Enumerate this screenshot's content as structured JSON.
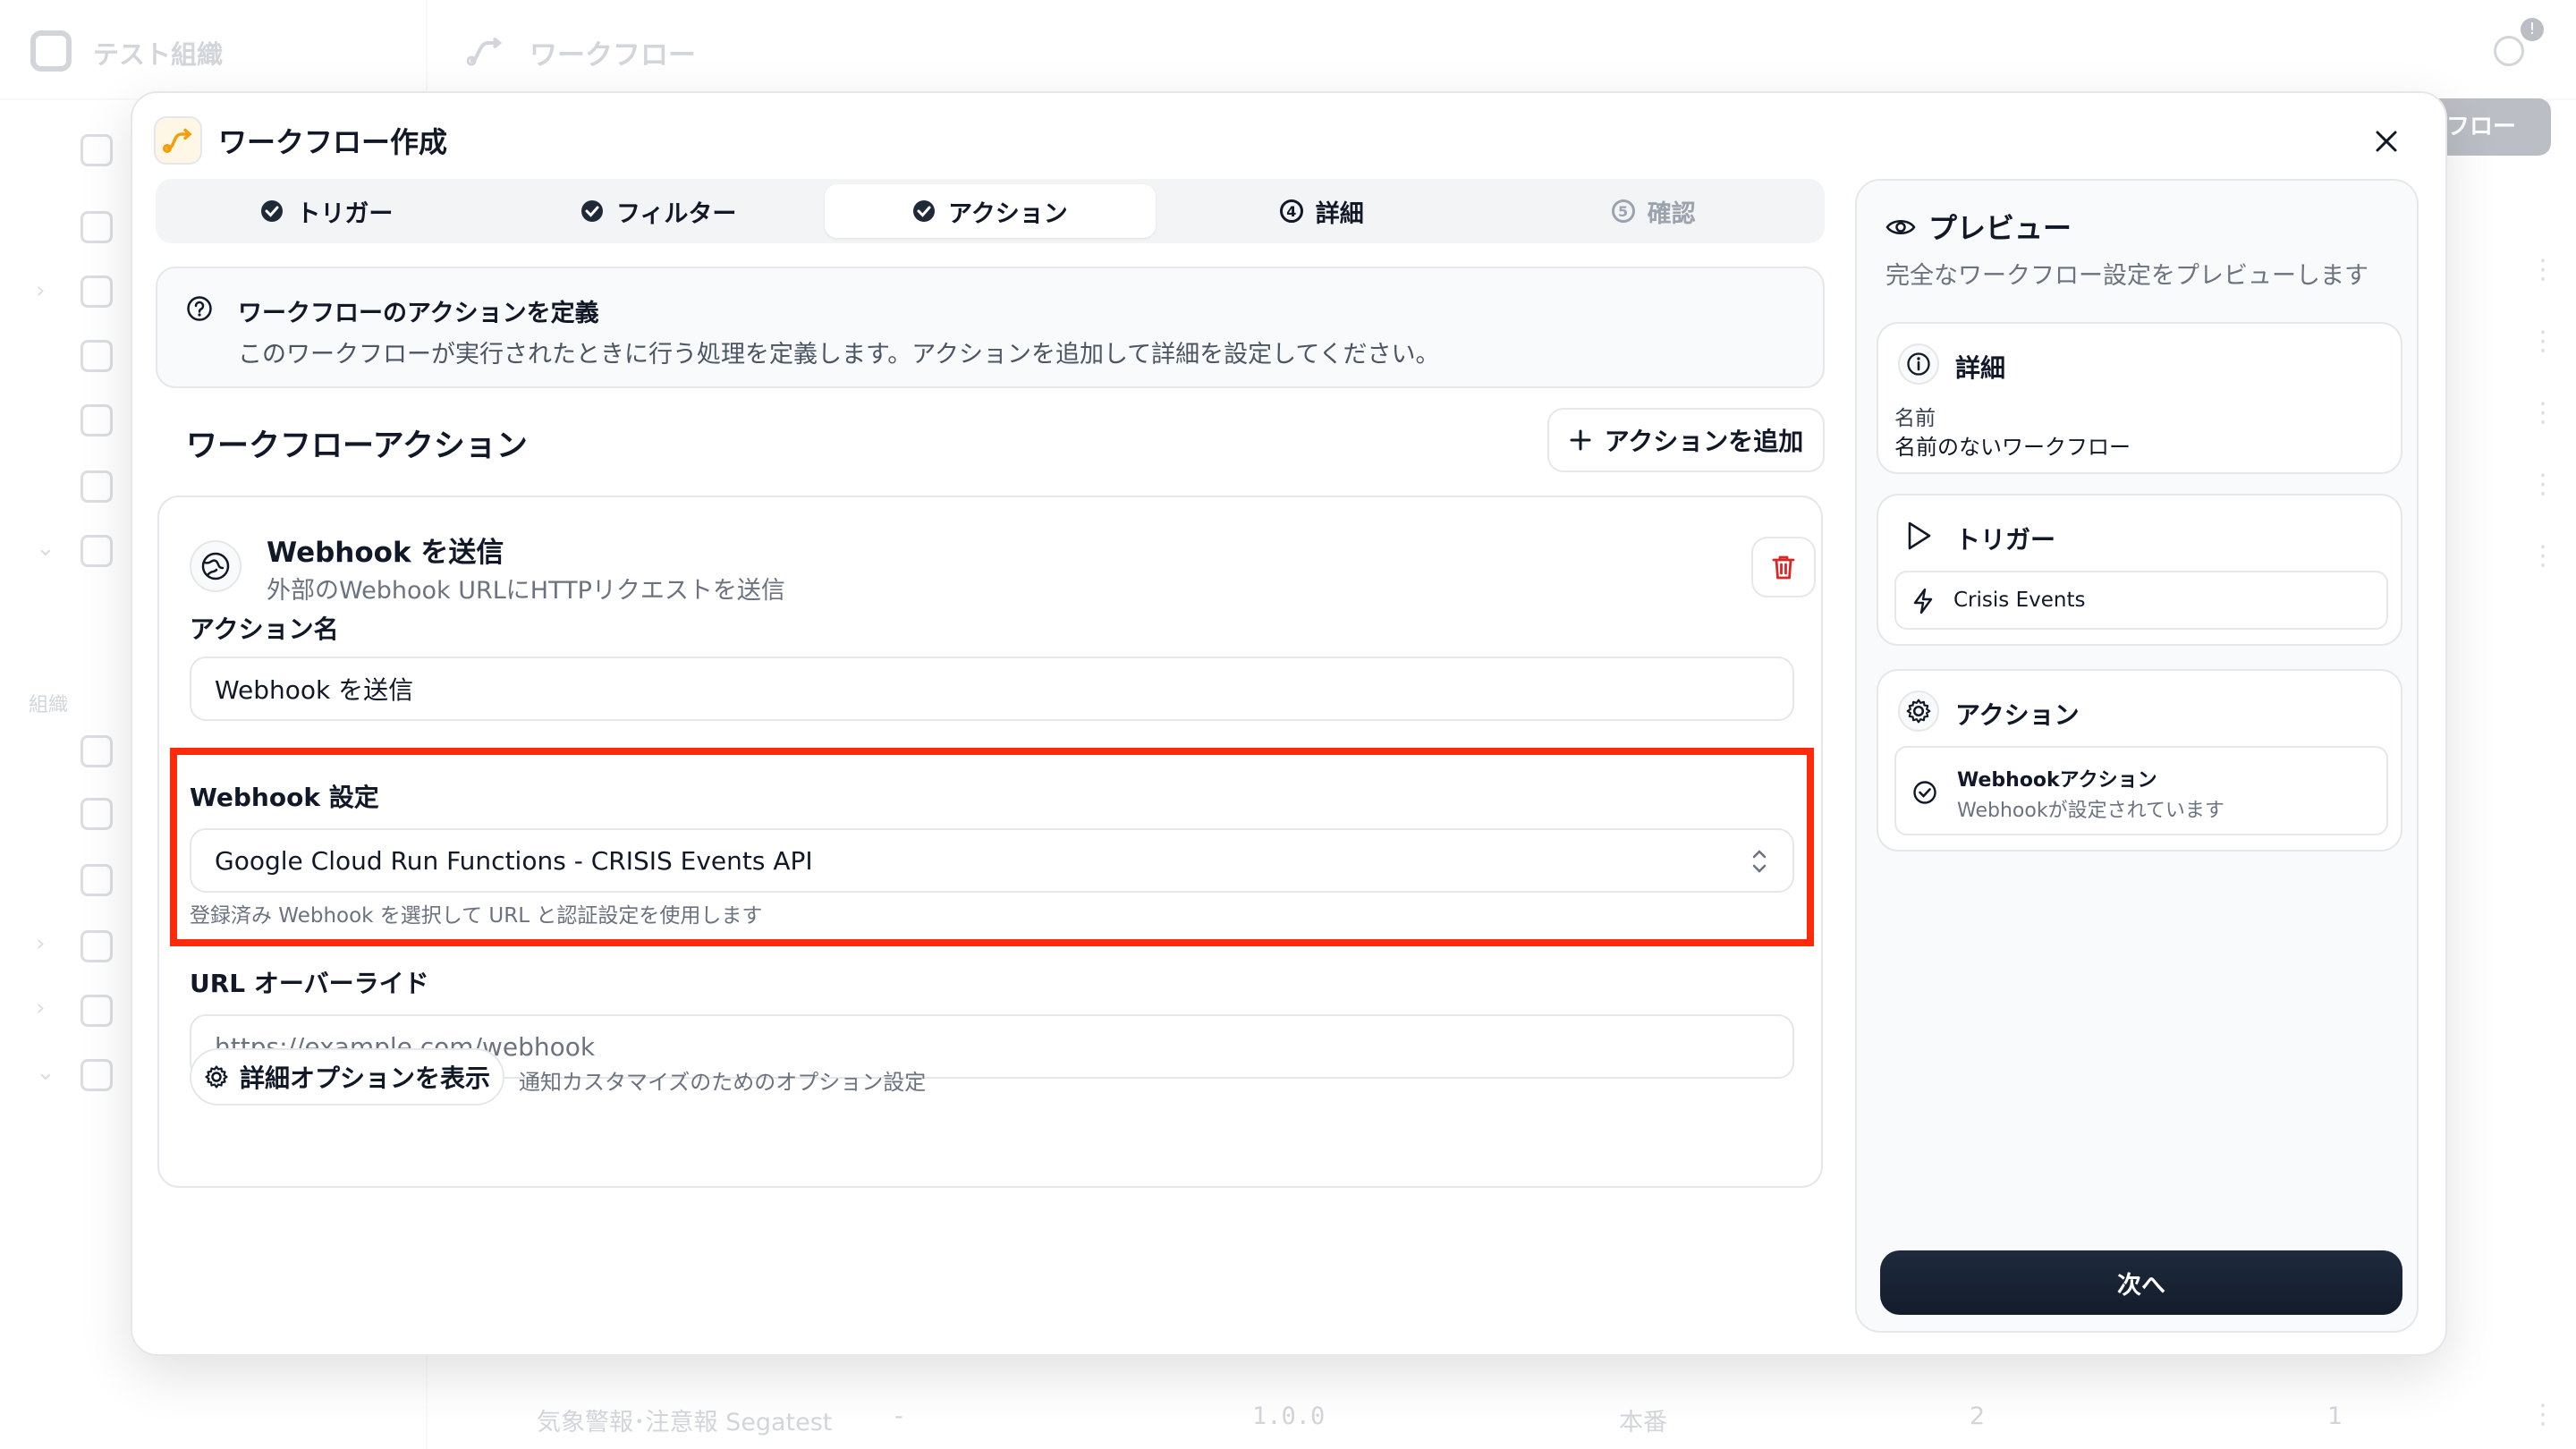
{
  "background": {
    "org_name": "テスト組織",
    "page_title": "ワークフロー",
    "section_label": "組織",
    "right_button_label": "フロー",
    "notification_count": "!",
    "row": {
      "name": "気象警報･注意報 Segatest",
      "dash": "-",
      "version": "1.0.0",
      "env": "本番",
      "count_a": "2",
      "count_b": "1"
    }
  },
  "modal": {
    "title": "ワークフロー作成",
    "steps": [
      {
        "label": "トリガー",
        "state": "done"
      },
      {
        "label": "フィルター",
        "state": "done"
      },
      {
        "label": "アクション",
        "state": "active"
      },
      {
        "label": "詳細",
        "state": "next",
        "number": "4"
      },
      {
        "label": "確認",
        "state": "pending",
        "number": "5"
      }
    ],
    "info": {
      "title": "ワークフローのアクションを定義",
      "description": "このワークフローが実行されたときに行う処理を定義します。アクションを追加して詳細を設定してください。"
    },
    "section_title": "ワークフローアクション",
    "add_action_label": "アクションを追加",
    "action_card": {
      "title": "Webhook を送信",
      "description": "外部のWebhook URLにHTTPリクエストを送信",
      "name_label": "アクション名",
      "name_value": "Webhook を送信",
      "webhook_label": "Webhook 設定",
      "webhook_value": "Google Cloud Run Functions - CRISIS Events API",
      "webhook_hint": "登録済み Webhook を選択して URL と認証設定を使用します",
      "url_label": "URL オーバーライド",
      "url_placeholder": "https://example.com/webhook",
      "options_button": "詳細オプションを表示",
      "options_hint": "通知カスタマイズのためのオプション設定"
    }
  },
  "preview": {
    "title": "プレビュー",
    "description": "完全なワークフロー設定をプレビューします",
    "details": {
      "title": "詳細",
      "name_label": "名前",
      "name_value": "名前のないワークフロー"
    },
    "trigger": {
      "title": "トリガー",
      "item": "Crisis Events"
    },
    "action": {
      "title": "アクション",
      "item_title": "Webhookアクション",
      "item_desc": "Webhookが設定されています"
    },
    "next_button": "次へ"
  },
  "colors": {
    "highlight": "#ff2a0c",
    "delete": "#dc2626",
    "primary_button": "#1a2436",
    "accent_icon": "#f59e0b"
  }
}
